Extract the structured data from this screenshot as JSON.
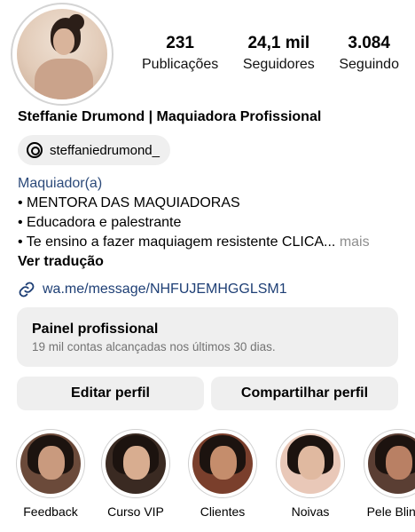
{
  "profile": {
    "name": "Steffanie Drumond | Maquiadora Profissional",
    "threads_handle": "steffaniedrumond_"
  },
  "stats": [
    {
      "value": "231",
      "label": "Publicações"
    },
    {
      "value": "24,1 mil",
      "label": "Seguidores"
    },
    {
      "value": "3.084",
      "label": "Seguindo"
    }
  ],
  "bio": {
    "category": "Maquiador(a)",
    "lines": [
      "• MENTORA DAS MAQUIADORAS",
      "• Educadora e palestrante",
      "• Te ensino a fazer maquiagem resistente CLICA..."
    ],
    "more": "mais",
    "translate": "Ver tradução"
  },
  "link": {
    "text": "wa.me/message/NHFUJEMHGGLSM1"
  },
  "dashboard": {
    "title": "Painel profissional",
    "subtitle": "19 mil contas alcançadas nos últimos 30 dias."
  },
  "buttons": {
    "edit": "Editar perfil",
    "share": "Compartilhar perfil"
  },
  "highlights": [
    {
      "label": "Feedback",
      "bg": "#6b4a3a",
      "skin": "#c99a7e"
    },
    {
      "label": "Curso VIP",
      "bg": "#3a2a22",
      "skin": "#d8ad90"
    },
    {
      "label": "Clientes",
      "bg": "#7a3f2c",
      "skin": "#c58d6c"
    },
    {
      "label": "Noivas",
      "bg": "#e9c8b8",
      "skin": "#e0b9a0"
    },
    {
      "label": "Pele Blinda",
      "bg": "#5a3e33",
      "skin": "#b98064"
    }
  ],
  "colors": {
    "link": "#1e3f75",
    "category": "#2c4a7a",
    "panel": "#efefef",
    "muted": "#737373"
  }
}
